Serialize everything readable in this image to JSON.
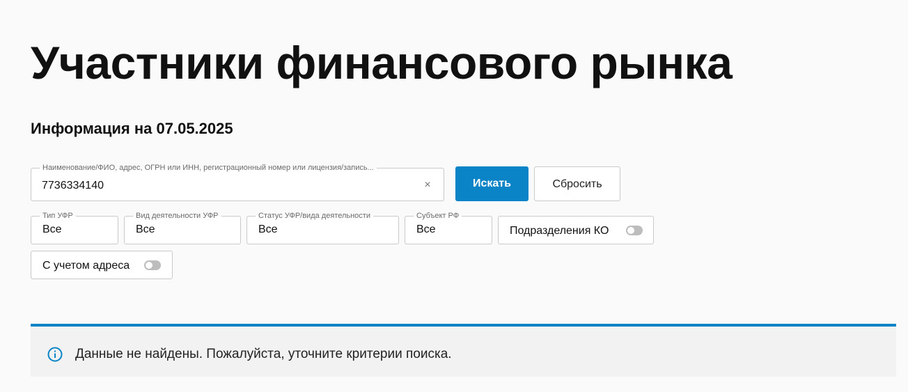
{
  "page": {
    "title": "Участники финансового рынка",
    "info_date": "Информация на 07.05.2025"
  },
  "search": {
    "label": "Наименование/ФИО, адрес, ОГРН или ИНН, регистрационный номер или лицензия/запись...",
    "value": "7736334140",
    "clear_icon": "clear-icon",
    "clear_glyph": "×"
  },
  "buttons": {
    "search_label": "Искать",
    "reset_label": "Сбросить"
  },
  "filters": {
    "type": {
      "label": "Тип УФР",
      "value": "Все"
    },
    "activity": {
      "label": "Вид деятельности УФР",
      "value": "Все"
    },
    "status": {
      "label": "Статус УФР/вида деятельности",
      "value": "Все"
    },
    "region": {
      "label": "Субъект РФ",
      "value": "Все"
    }
  },
  "toggles": {
    "branches": {
      "label": "Подразделения КО",
      "on": false
    },
    "address": {
      "label": "С учетом адреса",
      "on": false
    }
  },
  "notice": {
    "icon": "info-icon",
    "text": "Данные не найдены. Пожалуйста, уточните критерии поиска."
  },
  "colors": {
    "accent": "#0a84c7",
    "notice_background": "#f2f2f2",
    "toggle_off": "#bdbdbd"
  }
}
